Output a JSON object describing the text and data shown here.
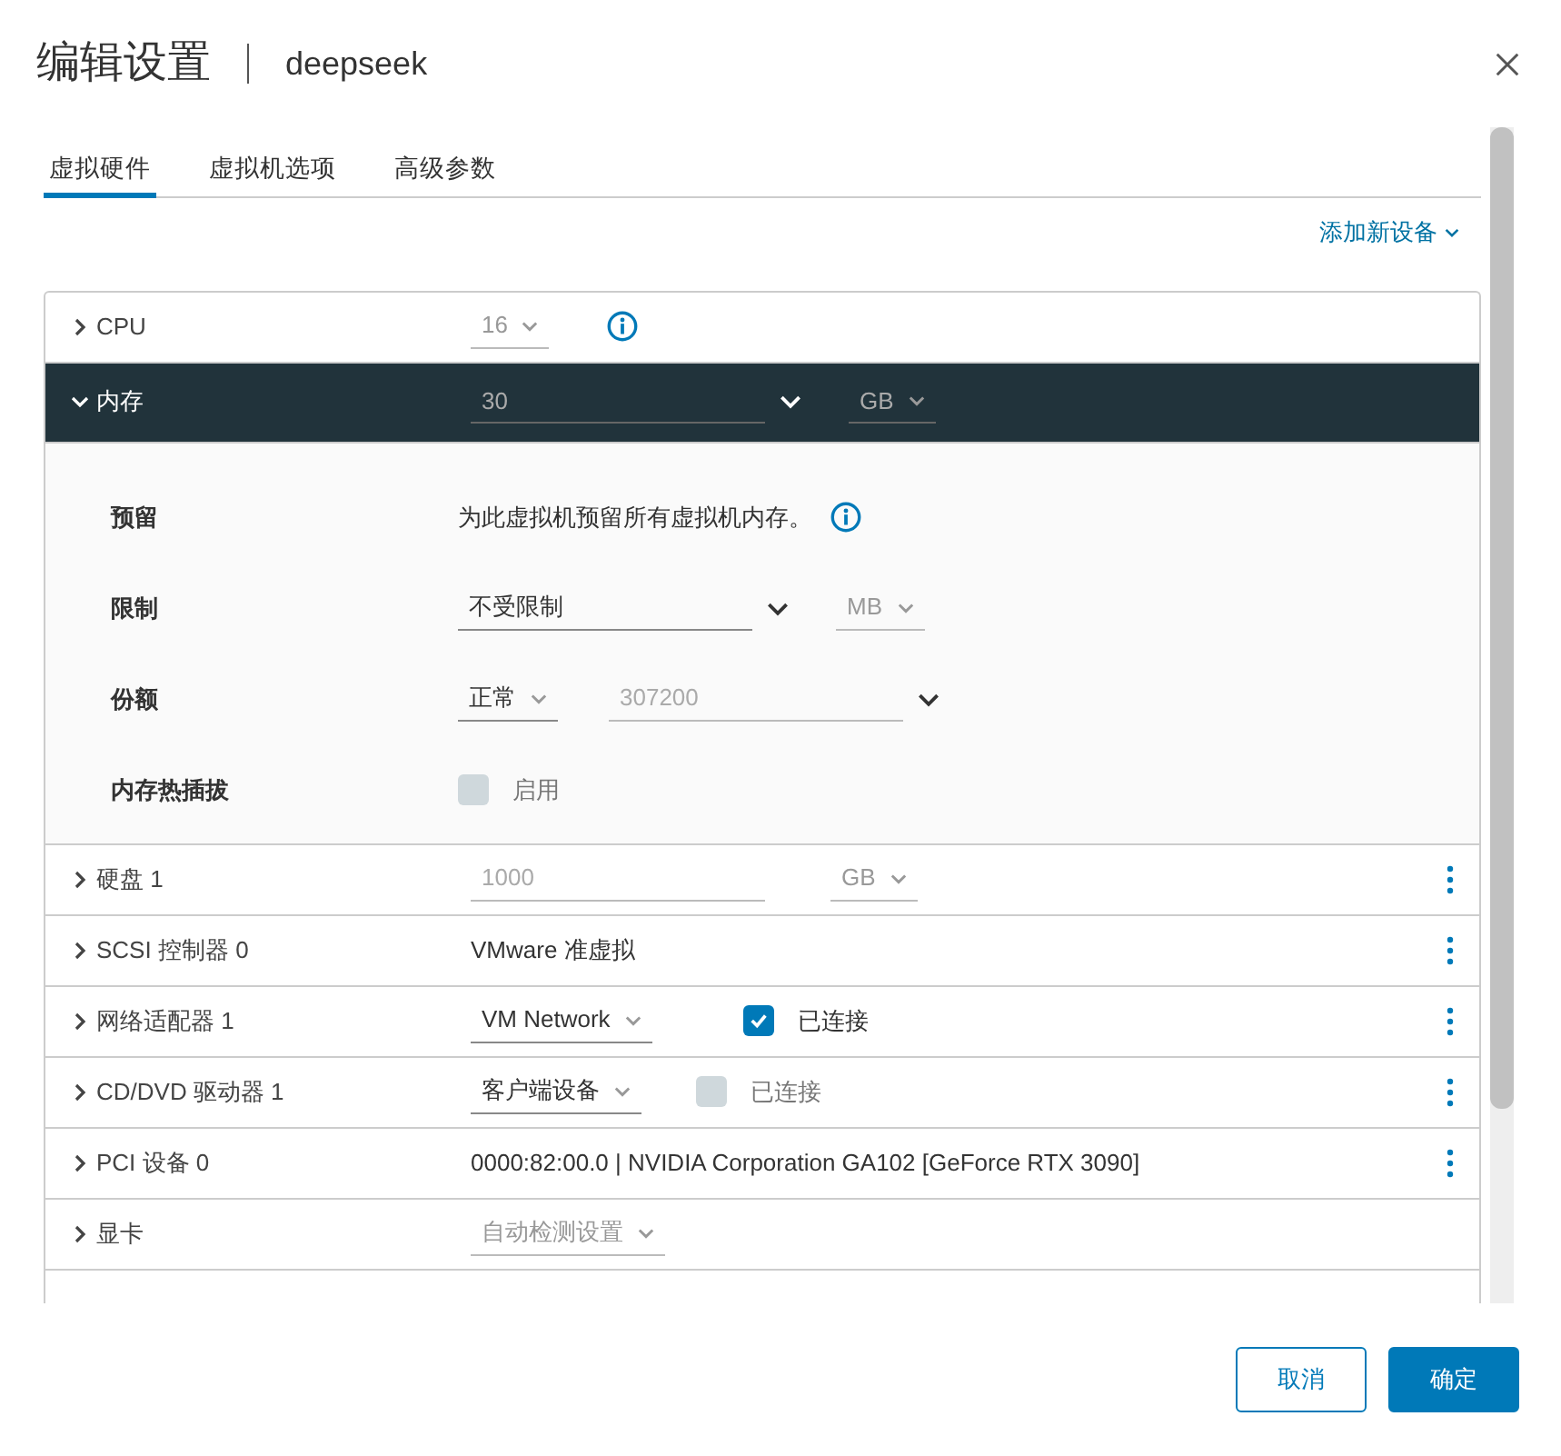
{
  "dialog": {
    "title": "编辑设置",
    "subtitle": "deepseek"
  },
  "tabs": [
    {
      "label": "虚拟硬件",
      "selected": true
    },
    {
      "label": "虚拟机选项",
      "selected": false
    },
    {
      "label": "高级参数",
      "selected": false
    }
  ],
  "add_device": {
    "label": "添加新设备"
  },
  "devices": [
    {
      "label": "CPU",
      "expanded": false,
      "menu": false,
      "controls": [
        {
          "kind": "select",
          "value": "16",
          "disabled": true
        },
        {
          "kind": "info"
        }
      ]
    },
    {
      "label": "内存",
      "expanded": true,
      "menu": false,
      "controls": [
        {
          "kind": "combo",
          "value": "30",
          "disabled": true
        },
        {
          "kind": "select",
          "value": "GB",
          "disabled": true
        }
      ],
      "details": [
        {
          "label": "预留",
          "controls": [
            {
              "kind": "text",
              "value": "为此虚拟机预留所有虚拟机内存。"
            },
            {
              "kind": "info"
            }
          ]
        },
        {
          "label": "限制",
          "controls": [
            {
              "kind": "combo",
              "value": "不受限制",
              "disabled": false
            },
            {
              "kind": "select",
              "value": "MB",
              "disabled": true
            }
          ]
        },
        {
          "label": "份额",
          "controls": [
            {
              "kind": "select",
              "value": "正常",
              "disabled": false
            },
            {
              "kind": "combo",
              "value": "307200",
              "disabled": true
            }
          ]
        },
        {
          "label": "内存热插拔",
          "controls": [
            {
              "kind": "checkbox",
              "value": "启用",
              "checked": false,
              "disabled": true
            }
          ]
        }
      ]
    },
    {
      "label": "硬盘 1",
      "expanded": false,
      "menu": true,
      "controls": [
        {
          "kind": "input",
          "value": "1000",
          "disabled": true
        },
        {
          "kind": "select",
          "value": "GB",
          "disabled": true
        }
      ]
    },
    {
      "label": "SCSI 控制器 0",
      "expanded": false,
      "menu": true,
      "controls": [
        {
          "kind": "text",
          "value": "VMware 准虚拟"
        }
      ]
    },
    {
      "label": "网络适配器 1",
      "expanded": false,
      "menu": true,
      "controls": [
        {
          "kind": "select",
          "value": "VM Network",
          "disabled": false
        },
        {
          "kind": "checkbox",
          "value": "已连接",
          "checked": true,
          "disabled": false
        }
      ]
    },
    {
      "label": "CD/DVD 驱动器 1",
      "expanded": false,
      "menu": true,
      "controls": [
        {
          "kind": "select",
          "value": "客户端设备",
          "disabled": false
        },
        {
          "kind": "checkbox",
          "value": "已连接",
          "checked": false,
          "disabled": true
        }
      ]
    },
    {
      "label": "PCI 设备 0",
      "expanded": false,
      "menu": true,
      "controls": [
        {
          "kind": "text",
          "value": "0000:82:00.0 | NVIDIA Corporation GA102 [GeForce RTX 3090]"
        }
      ]
    },
    {
      "label": "显卡",
      "expanded": false,
      "menu": false,
      "controls": [
        {
          "kind": "select",
          "value": "自动检测设置",
          "disabled": true
        }
      ]
    }
  ],
  "buttons": [
    {
      "label": "取消",
      "kind": "secondary"
    },
    {
      "label": "确定",
      "kind": "primary"
    }
  ]
}
